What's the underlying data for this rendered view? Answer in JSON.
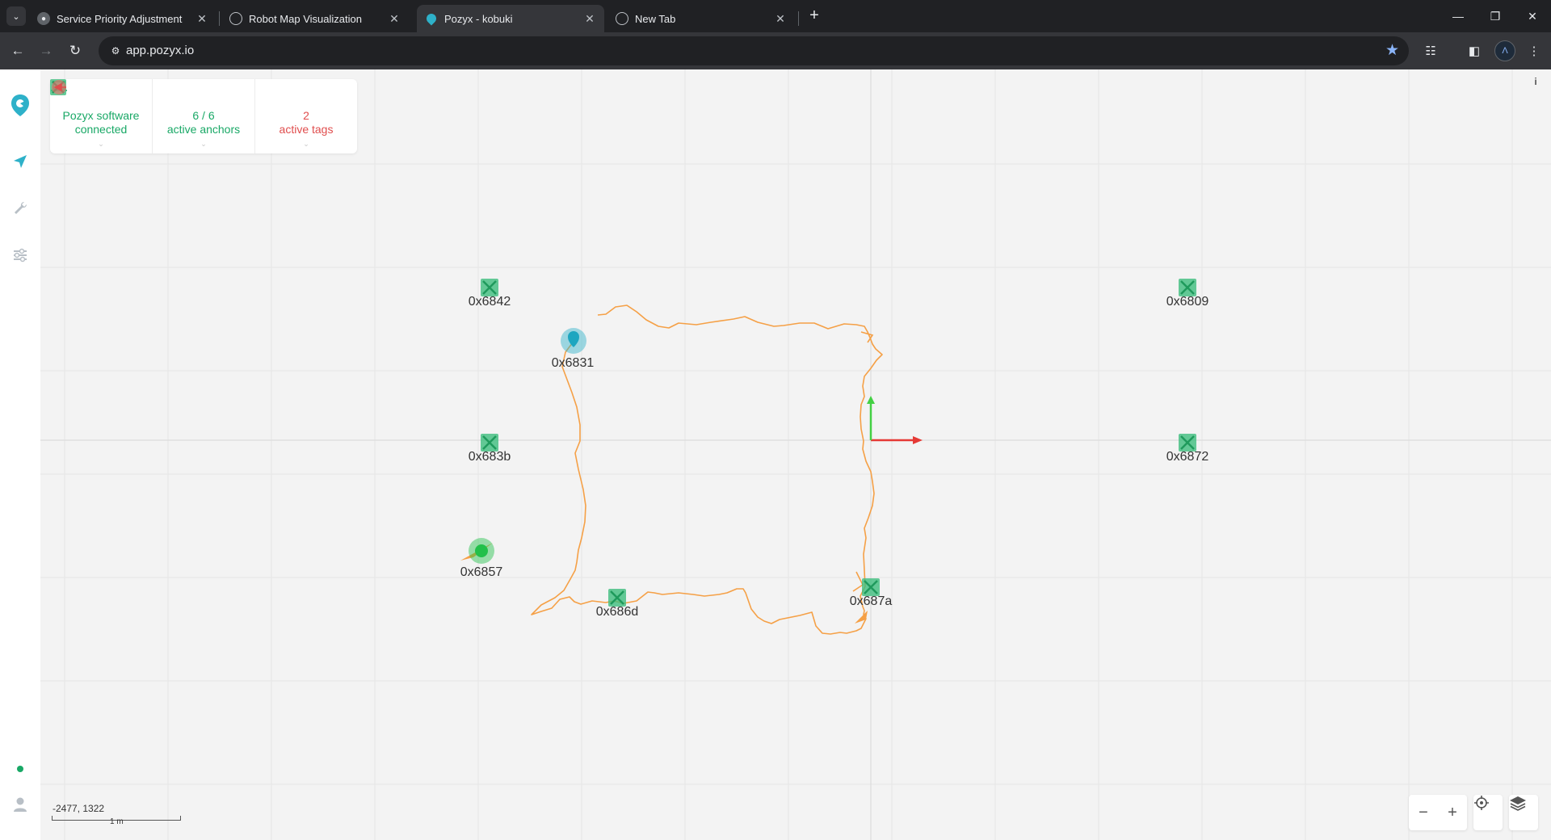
{
  "browser": {
    "tabs": [
      {
        "title": "Service Priority Adjustment",
        "active": false
      },
      {
        "title": "Robot Map Visualization",
        "active": false
      },
      {
        "title": "Pozyx - kobuki",
        "active": true
      },
      {
        "title": "New Tab",
        "active": false
      }
    ],
    "url": "app.pozyx.io"
  },
  "status": {
    "software_line1": "Pozyx software",
    "software_line2": "connected",
    "anchors_count": "6 / 6",
    "anchors_label": "active anchors",
    "tags_count": "2",
    "tags_label": "active tags"
  },
  "anchors": [
    {
      "id": "0x6842"
    },
    {
      "id": "0x6809"
    },
    {
      "id": "0x683b"
    },
    {
      "id": "0x6872"
    },
    {
      "id": "0x686d"
    },
    {
      "id": "0x687a"
    }
  ],
  "tags": [
    {
      "id": "0x6831",
      "color": "#2eb1c9"
    },
    {
      "id": "0x6857",
      "color": "#22c04a"
    }
  ],
  "map": {
    "cursor_coords": "-2477, 1322",
    "scale_label": "1 m"
  },
  "colors": {
    "accent": "#2eb1c9",
    "anchor": "#3dbd7d",
    "ok_green": "#19a866",
    "alert_red": "#e04d4d",
    "trail": "#f5a046",
    "axis_x": "#e53935",
    "axis_y": "#43d043"
  }
}
